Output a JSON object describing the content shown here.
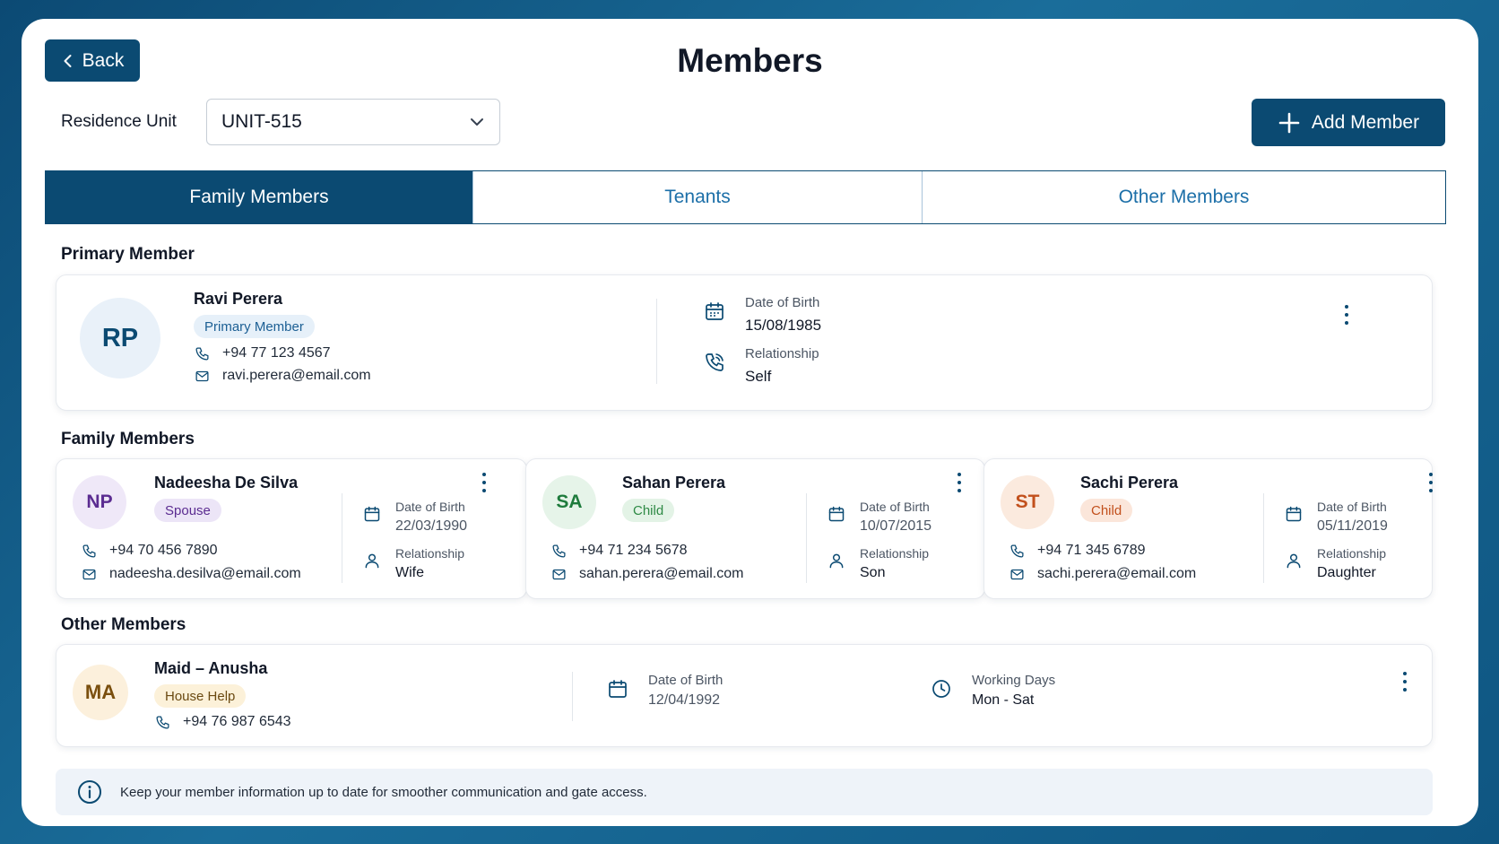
{
  "header": {
    "back_label": "Back",
    "title": "Members",
    "add_label": "Add Member"
  },
  "unit": {
    "label": "Residence Unit",
    "value": "UNIT-515"
  },
  "tabs": [
    {
      "label": "Family Members",
      "active": true
    },
    {
      "label": "Tenants",
      "active": false
    },
    {
      "label": "Other Members",
      "active": false
    }
  ],
  "primary": {
    "section": "Primary Member",
    "initials": "RP",
    "name": "Ravi Perera",
    "badge": "Primary Member",
    "phone": "+94 77 123 4567",
    "email": "ravi.perera@email.com",
    "dob_label": "Date of Birth",
    "dob": "15/08/1985",
    "rel_label": "Relationship",
    "rel": "Self"
  },
  "family": {
    "section": "Family Members",
    "members": [
      {
        "initials": "NP",
        "name": "Nadeesha De Silva",
        "badge": "Spouse",
        "phone": "+94 70 456 7890",
        "email": "nadeesha.desilva@email.com",
        "dob_label": "Date of Birth",
        "dob": "22/03/1990",
        "rel_label": "Relationship",
        "rel": "Wife"
      },
      {
        "initials": "SA",
        "name": "Sahan Perera",
        "badge": "Child",
        "phone": "+94 71 234 5678",
        "email": "sahan.perera@email.com",
        "dob_label": "Date of Birth",
        "dob": "10/07/2015",
        "rel_label": "Relationship",
        "rel": "Son"
      },
      {
        "initials": "ST",
        "name": "Sachi Perera",
        "badge": "Child",
        "phone": "+94 71 345 6789",
        "email": "sachi.perera@email.com",
        "dob_label": "Date of Birth",
        "dob": "05/11/2019",
        "rel_label": "Relationship",
        "rel": "Daughter"
      }
    ]
  },
  "other": {
    "section": "Other Members",
    "initials": "MA",
    "name": "Maid – Anusha",
    "badge": "House Help",
    "phone": "+94 76 987 6543",
    "dob_label": "Date of Birth",
    "dob": "12/04/1992",
    "days_label": "Working Days",
    "days": "Mon - Sat"
  },
  "note": "Keep your member information up to date for smoother communication and gate access.",
  "colors": {
    "primary": "#0b4a72",
    "link": "#1c6fa8",
    "spouse_badge": "#ece5f7",
    "child_green_badge": "#e3f3e6",
    "child_orange_badge": "#fbe6da",
    "house_help_badge": "#fcf1d9"
  }
}
